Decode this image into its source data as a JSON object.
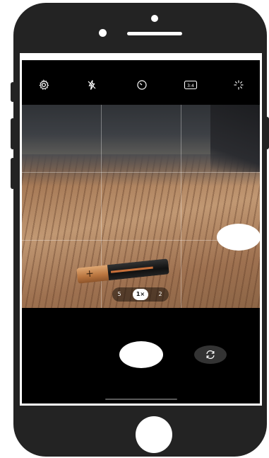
{
  "toolbar": {
    "icons": [
      "settings-icon",
      "flash-off-icon",
      "timer-icon",
      "aspect-ratio-icon",
      "filters-icon"
    ],
    "aspect_ratio": "3:4"
  },
  "zoom": {
    "options": [
      "5",
      "1×",
      "2"
    ],
    "selected": "1×"
  },
  "battery_label": "+",
  "colors": {
    "screen_background": "#000000",
    "phone_body": "#232323",
    "shutter": "#ffffff"
  }
}
